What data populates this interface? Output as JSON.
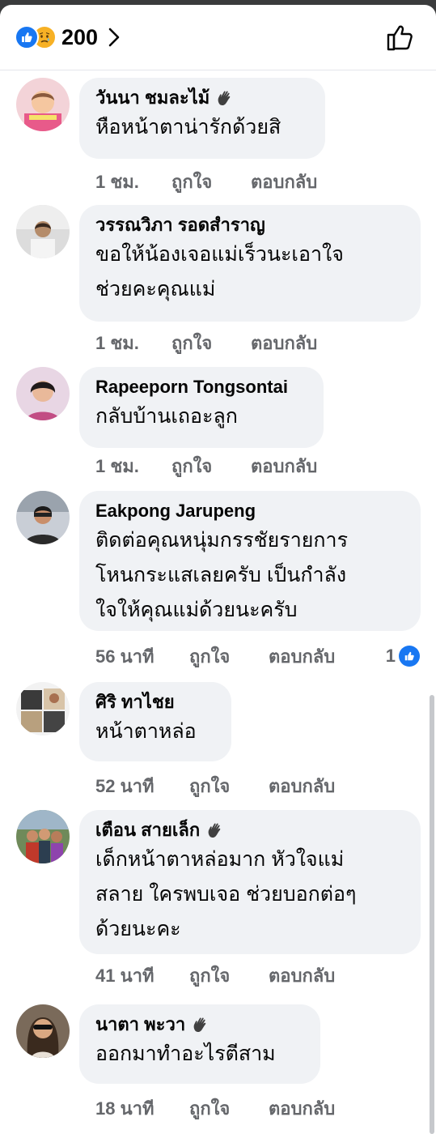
{
  "header": {
    "reaction_count": "200",
    "reaction_icons": [
      "like-icon",
      "sad-icon"
    ]
  },
  "comments": [
    {
      "name": "วันนา ชมละไม้",
      "lines": [
        "หือหน้าตาน่ารักด้วยสิ"
      ],
      "time": "1 ชม.",
      "like": "ถูกใจ",
      "reply": "ตอบกลับ",
      "wave": true
    },
    {
      "name": "วรรณวิภา รอดสำราญ",
      "lines": [
        "ขอให้น้องเจอแม่เร็วนะเอาใจ",
        "ช่วยคะคุณแม่"
      ],
      "time": "1 ชม.",
      "like": "ถูกใจ",
      "reply": "ตอบกลับ"
    },
    {
      "name": "Rapeeporn Tongsontai",
      "lines": [
        "กลับบ้านเถอะลูก"
      ],
      "time": "1 ชม.",
      "like": "ถูกใจ",
      "reply": "ตอบกลับ"
    },
    {
      "name": "Eakpong Jarupeng",
      "lines": [
        "ติดต่อคุณหนุ่มกรรชัยรายการ",
        "โหนกระแสเลยครับ เป็นกำลัง",
        "ใจให้คุณแม่ด้วยนะครับ"
      ],
      "time": "56 นาที",
      "like": "ถูกใจ",
      "reply": "ตอบกลับ",
      "reaction_count": "1"
    },
    {
      "name": "ศิริ ทาไชย",
      "lines": [
        "หน้าตาหล่อ"
      ],
      "time": "52 นาที",
      "like": "ถูกใจ",
      "reply": "ตอบกลับ"
    },
    {
      "name": "เตือน สายเล็ก",
      "lines": [
        "เด็กหน้าตาหล่อมาก หัวใจแม่",
        "สลาย ใครพบเจอ ช่วยบอกต่อๆ",
        "ด้วยนะคะ"
      ],
      "time": "41 นาที",
      "like": "ถูกใจ",
      "reply": "ตอบกลับ",
      "wave": true
    },
    {
      "name": "นาตา พะวา",
      "lines": [
        "ออกมาทำอะไรตีสาม"
      ],
      "time": "18 นาที",
      "like": "ถูกใจ",
      "reply": "ตอบกลับ",
      "wave": true
    }
  ],
  "colors": {
    "accent": "#1877f2",
    "bubble": "#f0f2f5",
    "meta": "#65676b"
  }
}
